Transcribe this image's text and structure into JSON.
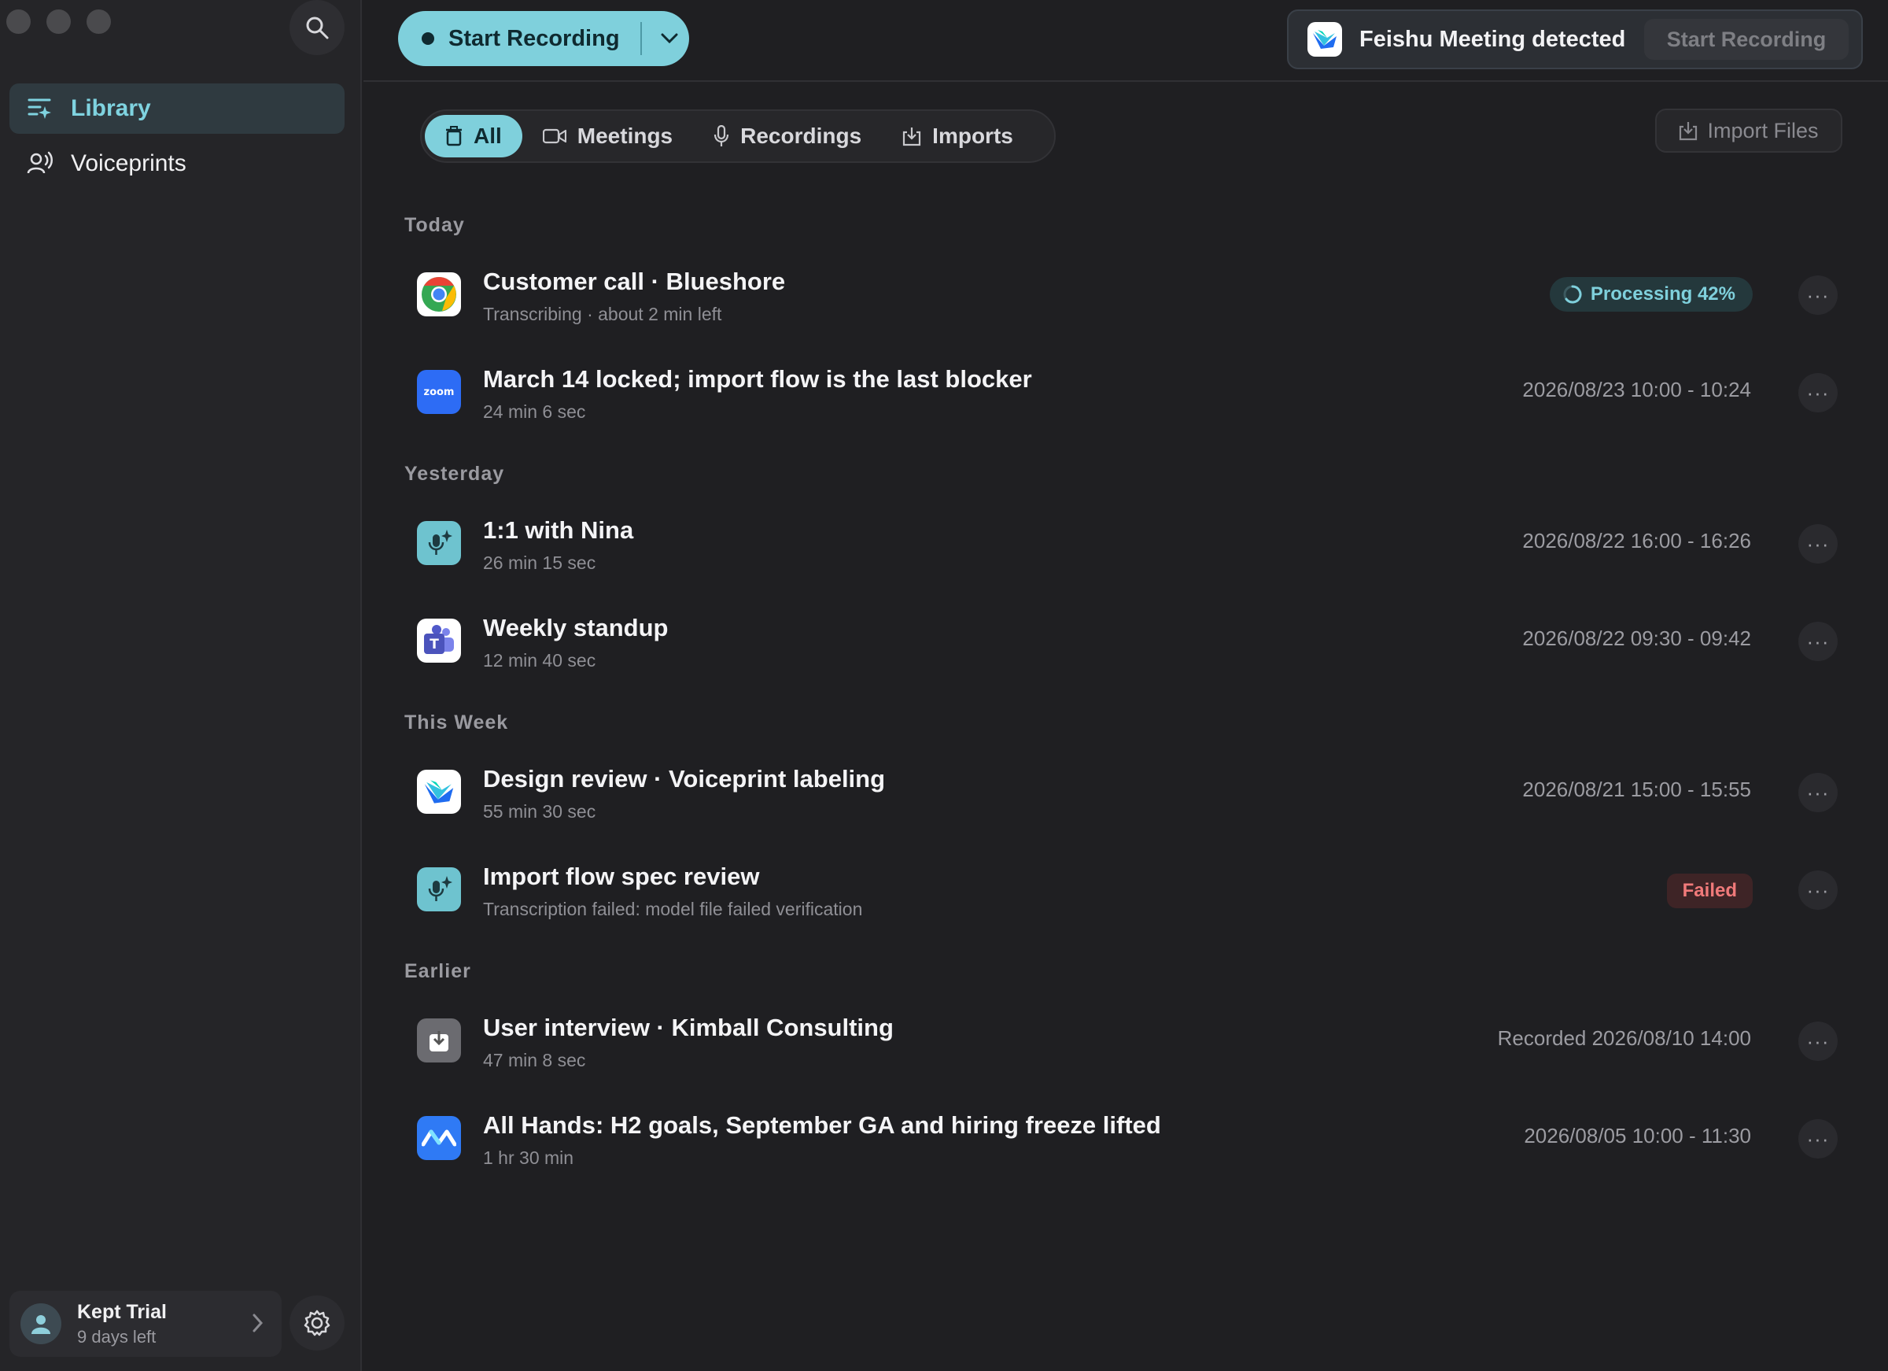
{
  "window": {
    "controls": [
      "close",
      "minimize",
      "zoom"
    ]
  },
  "sidebar": {
    "search_icon": "search-icon",
    "items": [
      {
        "label": "Library",
        "icon": "library-icon",
        "active": true
      },
      {
        "label": "Voiceprints",
        "icon": "voiceprint-icon",
        "active": false
      }
    ],
    "trial": {
      "title": "Kept Trial",
      "subtitle": "9 days left"
    }
  },
  "toolbar": {
    "record_label": "Start Recording",
    "detect_text": "Feishu Meeting detected",
    "detect_button": "Start Recording"
  },
  "filters": {
    "tabs": [
      {
        "label": "All",
        "icon": "trash-all-icon",
        "active": true
      },
      {
        "label": "Meetings",
        "icon": "video-icon",
        "active": false
      },
      {
        "label": "Recordings",
        "icon": "mic-icon",
        "active": false
      },
      {
        "label": "Imports",
        "icon": "import-icon",
        "active": false
      }
    ],
    "import_files": "Import Files"
  },
  "sections": [
    {
      "label": "Today"
    },
    {
      "label": "Yesterday"
    },
    {
      "label": "This Week"
    },
    {
      "label": "Earlier"
    }
  ],
  "rows": [
    {
      "title": "Customer call · Blueshore",
      "sub": "Transcribing · about 2 min left",
      "app": "chrome-icon",
      "badge": "Processing 42%",
      "progress": 0.42
    },
    {
      "title": "March 14 locked; import flow is the last blocker",
      "sub": "24 min 6 sec",
      "app": "zoom-icon",
      "meta": "2026/08/23 10:00 - 10:24"
    },
    {
      "title": "1:1 with Nina",
      "sub": "26 min 15 sec",
      "app": "kept-mic-icon",
      "meta": "2026/08/22 16:00 - 16:26"
    },
    {
      "title": "Weekly standup",
      "sub": "12 min 40 sec",
      "app": "teams-icon",
      "meta": "2026/08/22 09:30 - 09:42"
    },
    {
      "title": "Design review · Voiceprint labeling",
      "sub": "55 min 30 sec",
      "app": "feishu-icon",
      "meta": "2026/08/21 15:00 - 15:55"
    },
    {
      "title": "Import flow spec review",
      "sub": "Transcription failed: model file failed verification",
      "app": "kept-mic-icon",
      "badge_failed": "Failed"
    },
    {
      "title": "User interview · Kimball Consulting",
      "sub": "47 min 8 sec",
      "app": "import-file-icon",
      "meta": "Recorded 2026/08/10 14:00"
    },
    {
      "title": "All Hands: H2 goals, September GA and hiring freeze lifted",
      "sub": "1 hr 30 min",
      "app": "tencent-meeting-icon",
      "meta": "2026/08/05 10:00 - 11:30"
    }
  ],
  "more_label": "···",
  "colors": {
    "accent": "#7fd0dc",
    "failed": "#f07a7a",
    "background": "#1f1f22"
  }
}
